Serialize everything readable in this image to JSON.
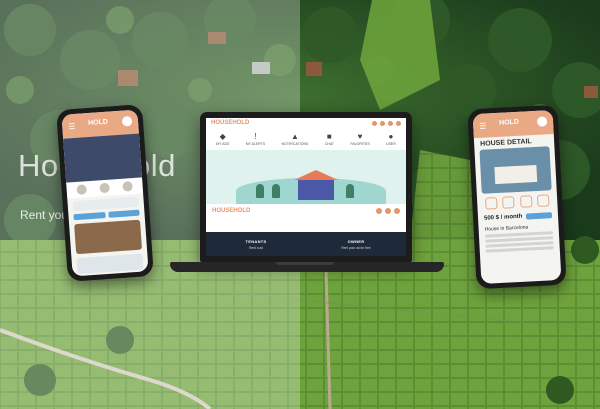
{
  "brand": {
    "title": "HouseHold",
    "tagline": "Rent your own house."
  },
  "laptop": {
    "logo": "HOUSEHOLD",
    "nav": [
      {
        "icon": "megaphone-icon",
        "glyph": "◆",
        "label": "MY ADS"
      },
      {
        "icon": "alert-icon",
        "glyph": "!",
        "label": "MY ALERTS"
      },
      {
        "icon": "bell-icon",
        "glyph": "▲",
        "label": "NOTIFICATIONS"
      },
      {
        "icon": "chat-icon",
        "glyph": "■",
        "label": "CHAT"
      },
      {
        "icon": "heart-icon",
        "glyph": "♥",
        "label": "FAVORITES"
      },
      {
        "icon": "user-icon",
        "glyph": "●",
        "label": "USER"
      }
    ],
    "brand_row_logo": "HOUSEHOLD",
    "footer": {
      "left_heading": "TENANTS",
      "left_sub": "Rent a ad",
      "right_heading": "OWNER",
      "right_sub": "Rent your ad for free"
    }
  },
  "phone_left": {
    "logo": "HOLD",
    "menu_glyph": "☰"
  },
  "phone_right": {
    "logo": "HOLD",
    "menu_glyph": "☰",
    "section_title": "HOUSE DETAIL",
    "price": "500 $ / month",
    "house_label": "House in Barcelona"
  },
  "colors": {
    "accent": "#e4956d",
    "link": "#5aa2d8",
    "footer": "#1e2a3a",
    "house": "#4b59a8"
  }
}
